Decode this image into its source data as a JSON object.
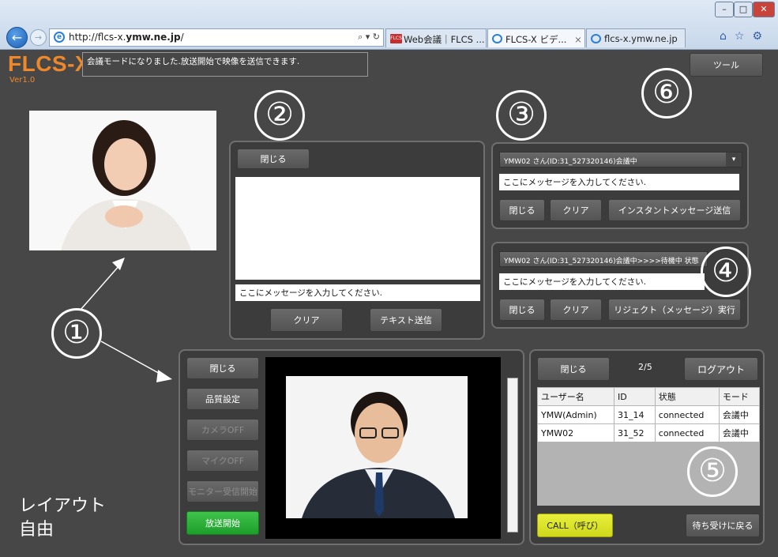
{
  "browser": {
    "url_prefix": "http://flcs-x.",
    "url_domain": "ymw.ne.jp",
    "url_suffix": "/",
    "addr_tools": "⌕ ▾ ↻",
    "tabs": [
      {
        "label": "Web会議｜FLCS ...",
        "favicon": "FLCS"
      },
      {
        "label": "FLCS-X ビデ...",
        "close": "×"
      },
      {
        "label": "flcs-x.ymw.ne.jp"
      }
    ],
    "window_buttons": [
      "–",
      "□",
      "✕"
    ],
    "icons": "⌂☆⚙"
  },
  "app": {
    "logo": "FLCS-X",
    "version": "Ver1.0",
    "status_message": "会議モードになりました.放送開始で映像を送信できます.",
    "tool_button": "ツール"
  },
  "callouts": [
    "①",
    "②",
    "③",
    "④",
    "⑤",
    "⑥"
  ],
  "layout_label": [
    "レイアウト",
    "自由"
  ],
  "text_panel": {
    "close": "閉じる",
    "input_placeholder": "ここにメッセージを入力してください.",
    "clear": "クリア",
    "send": "テキスト送信"
  },
  "instant_panel": {
    "recipient": "YMW02 さん(ID:31_527320146)会議中",
    "input_placeholder": "ここにメッセージを入力してください.",
    "close": "閉じる",
    "clear": "クリア",
    "send": "インスタントメッセージ送信"
  },
  "reject_panel": {
    "recipient": "YMW02 さん(ID:31_527320146)会議中>>>>待機中 状態",
    "input_placeholder": "ここにメッセージを入力してください.",
    "close": "閉じる",
    "clear": "クリア",
    "send": "リジェクト（メッセージ）実行"
  },
  "video_panel": {
    "buttons": [
      {
        "label": "閉じる",
        "state": "enabled"
      },
      {
        "label": "品質設定",
        "state": "enabled"
      },
      {
        "label": "カメラOFF",
        "state": "disabled"
      },
      {
        "label": "マイクOFF",
        "state": "disabled"
      },
      {
        "label": "モニター受信開始",
        "state": "disabled"
      },
      {
        "label": "放送開始",
        "state": "active"
      }
    ]
  },
  "user_panel": {
    "close": "閉じる",
    "count": "2/5",
    "logout": "ログアウト",
    "columns": [
      "ユーザー名",
      "ID",
      "状態",
      "モード"
    ],
    "rows": [
      [
        "YMW(Admin)",
        "31_14",
        "connected",
        "会議中"
      ],
      [
        "YMW02",
        "31_52",
        "connected",
        "会議中"
      ]
    ],
    "call": "CALL（呼び）",
    "back": "待ち受けに戻る"
  },
  "colors": {
    "logo": "#f0882a",
    "broadcast": "#2bb038",
    "call": "#d8df2a",
    "background": "#474747"
  }
}
